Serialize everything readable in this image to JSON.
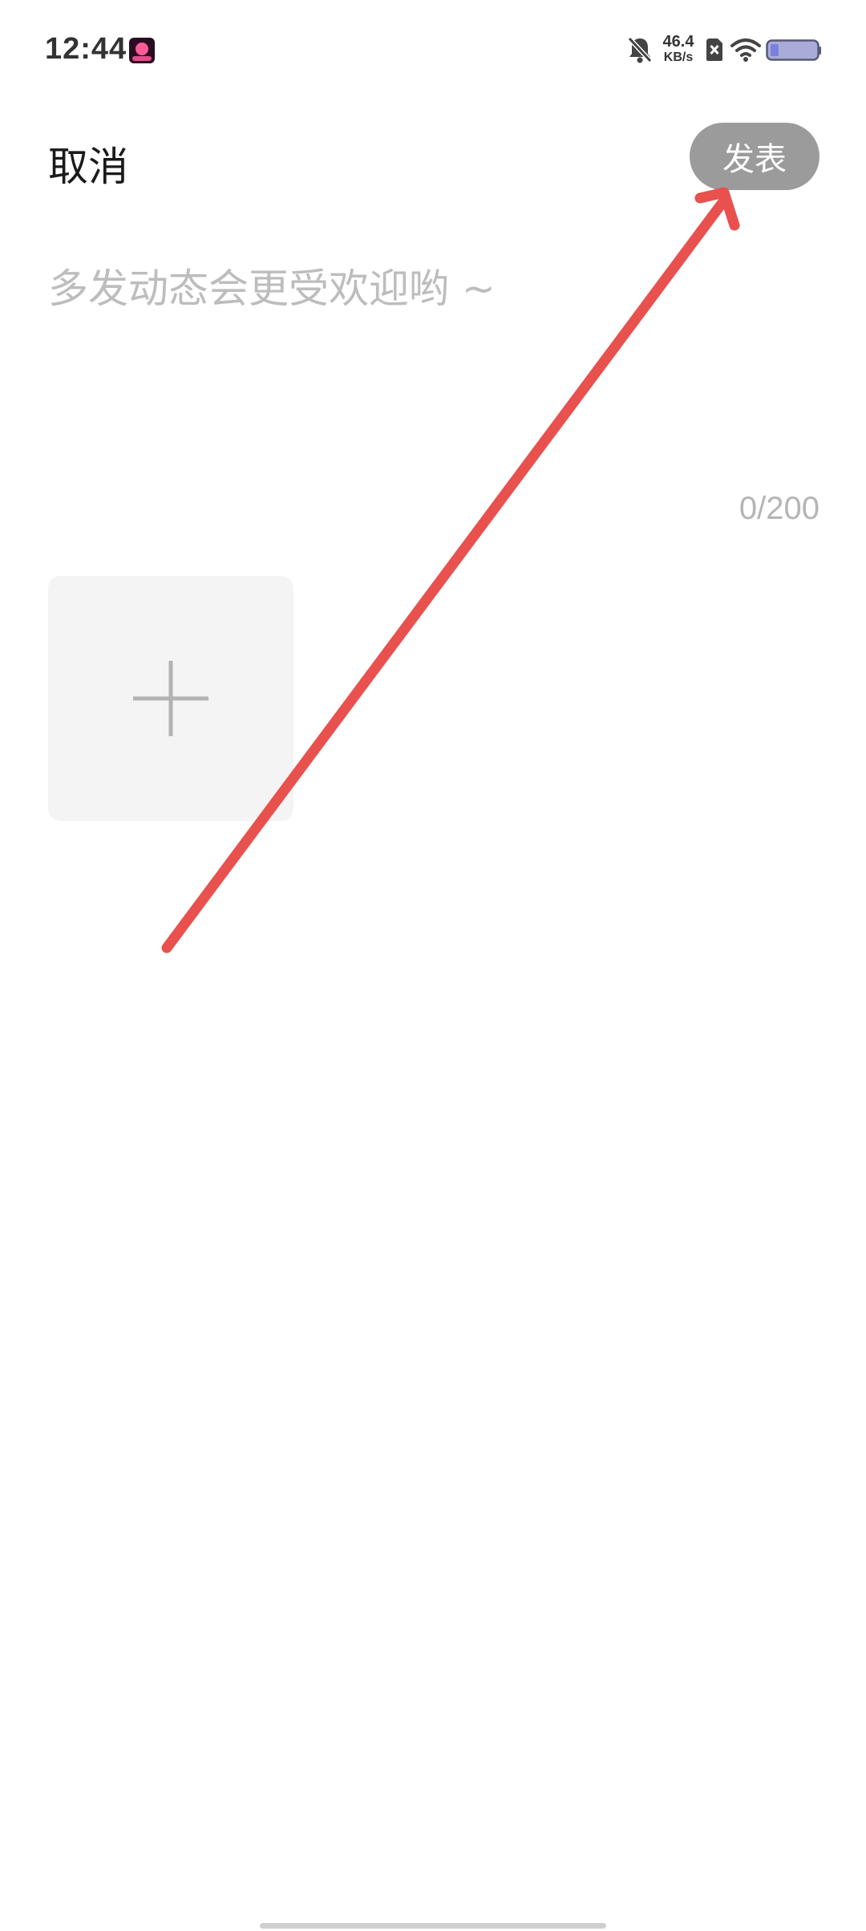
{
  "status_bar": {
    "time": "12:44",
    "net_speed_value": "46.4",
    "net_speed_unit": "KB/s",
    "icons": [
      "app-notification-icon",
      "bell-muted-icon",
      "sim-off-icon",
      "wifi-icon",
      "battery-icon"
    ]
  },
  "header": {
    "cancel_label": "取消",
    "publish_label": "发表"
  },
  "composer": {
    "placeholder": "多发动态会更受欢迎哟 ~",
    "value": "",
    "char_count": "0/200"
  },
  "media": {
    "add_icon": "plus-icon"
  },
  "annotation": {
    "arrow_color": "#e8514e"
  }
}
